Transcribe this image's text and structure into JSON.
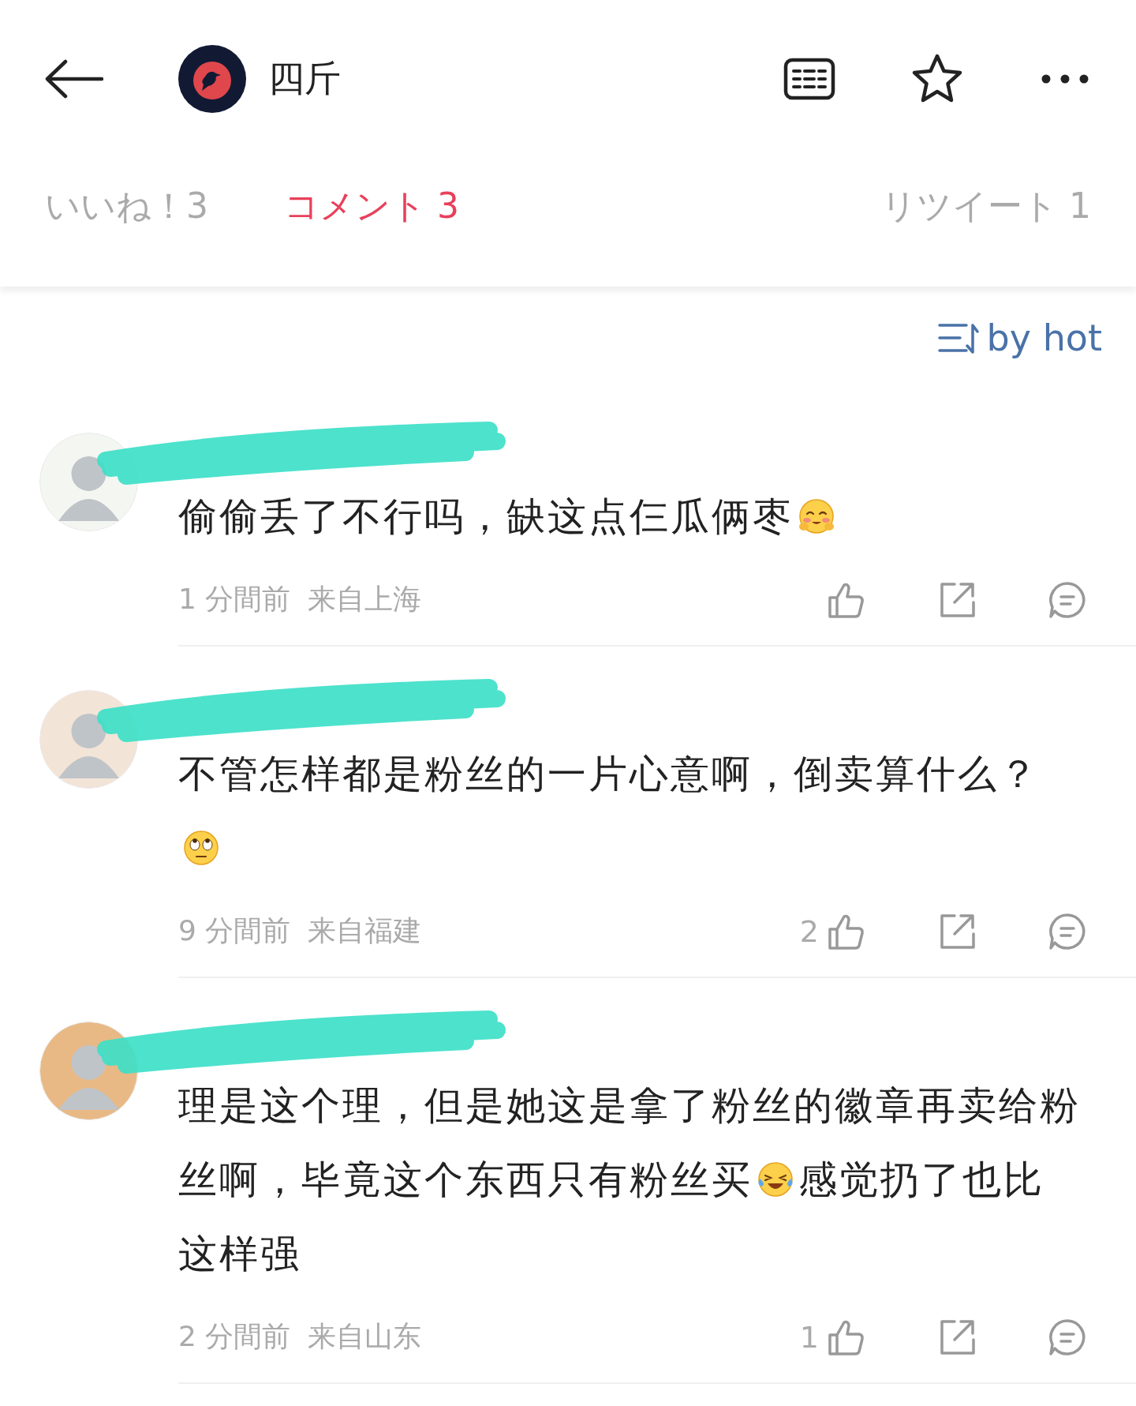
{
  "header": {
    "title": "四斤"
  },
  "tabs": [
    {
      "label": "いいね！3",
      "selected": false
    },
    {
      "label": "コメント 3",
      "selected": true
    },
    {
      "label": "リツイート 1",
      "selected": false
    }
  ],
  "sort": {
    "label": "by hot"
  },
  "comments": [
    {
      "body": [
        {
          "kind": "text",
          "text": "偷偷丢了不行吗，缺这点仨瓜俩枣"
        },
        {
          "kind": "blush"
        }
      ],
      "time": "1 分間前",
      "location": "来自上海"
    },
    {
      "body": [
        {
          "kind": "text",
          "text": "不管怎样都是粉丝的一片心意啊，倒卖算什么？"
        },
        {
          "kind": "eyeroll"
        }
      ],
      "time": "9 分間前",
      "location": "来自福建",
      "likes": "2"
    },
    {
      "body": [
        {
          "kind": "text",
          "text": "理是这个理，但是她这是拿了粉丝的徽章再卖给粉"
        },
        {
          "kind": "text",
          "text": "丝啊，毕竟这个东西只有粉丝买"
        },
        {
          "kind": "tears"
        },
        {
          "kind": "text",
          "text": "感觉扔了也比"
        },
        {
          "kind": "text",
          "text": "这样强"
        }
      ],
      "time": "2 分間前",
      "location": "来自山东",
      "likes": "1"
    }
  ]
}
